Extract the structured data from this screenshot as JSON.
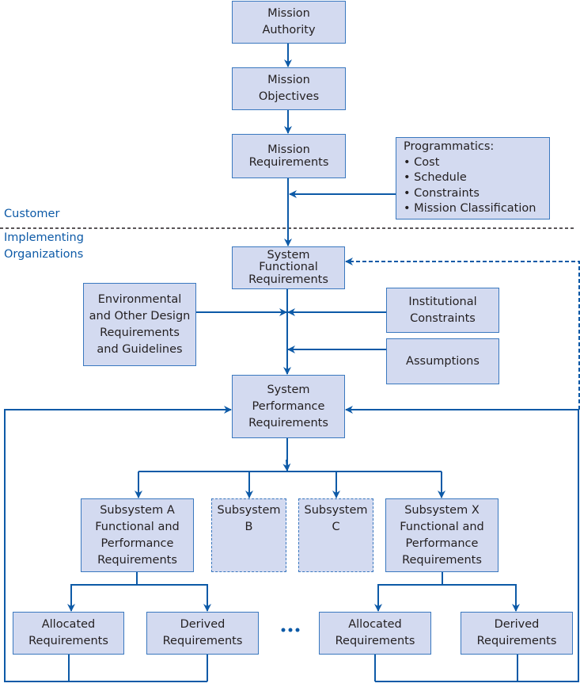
{
  "colors": {
    "box_fill": "#d3daf0",
    "line": "#0d5aa7",
    "label": "#0d5aa7"
  },
  "labels": {
    "customer": "Customer",
    "implementing": "Implementing\nOrganizations"
  },
  "boxes": {
    "mission_authority": "Mission\nAuthority",
    "mission_objectives": "Mission\nObjectives",
    "mission_requirements": "Mission\nRequirements",
    "programmatics": "Programmatics:\n• Cost\n• Schedule\n• Constraints\n• Mission Classification",
    "system_functional": "System\nFunctional\nRequirements",
    "environmental": "Environmental\nand Other Design\nRequirements\nand Guidelines",
    "institutional": "Institutional\nConstraints",
    "assumptions": "Assumptions",
    "system_performance": "System\nPerformance\nRequirements",
    "subsystem_a": "Subsystem A\nFunctional and\nPerformance\nRequirements",
    "subsystem_b": "Subsystem\nB",
    "subsystem_c": "Subsystem\nC",
    "subsystem_x": "Subsystem X\nFunctional and\nPerformance\nRequirements",
    "allocated_a": "Allocated\nRequirements",
    "derived_a": "Derived\nRequirements",
    "allocated_x": "Allocated\nRequirements",
    "derived_x": "Derived\nRequirements"
  }
}
